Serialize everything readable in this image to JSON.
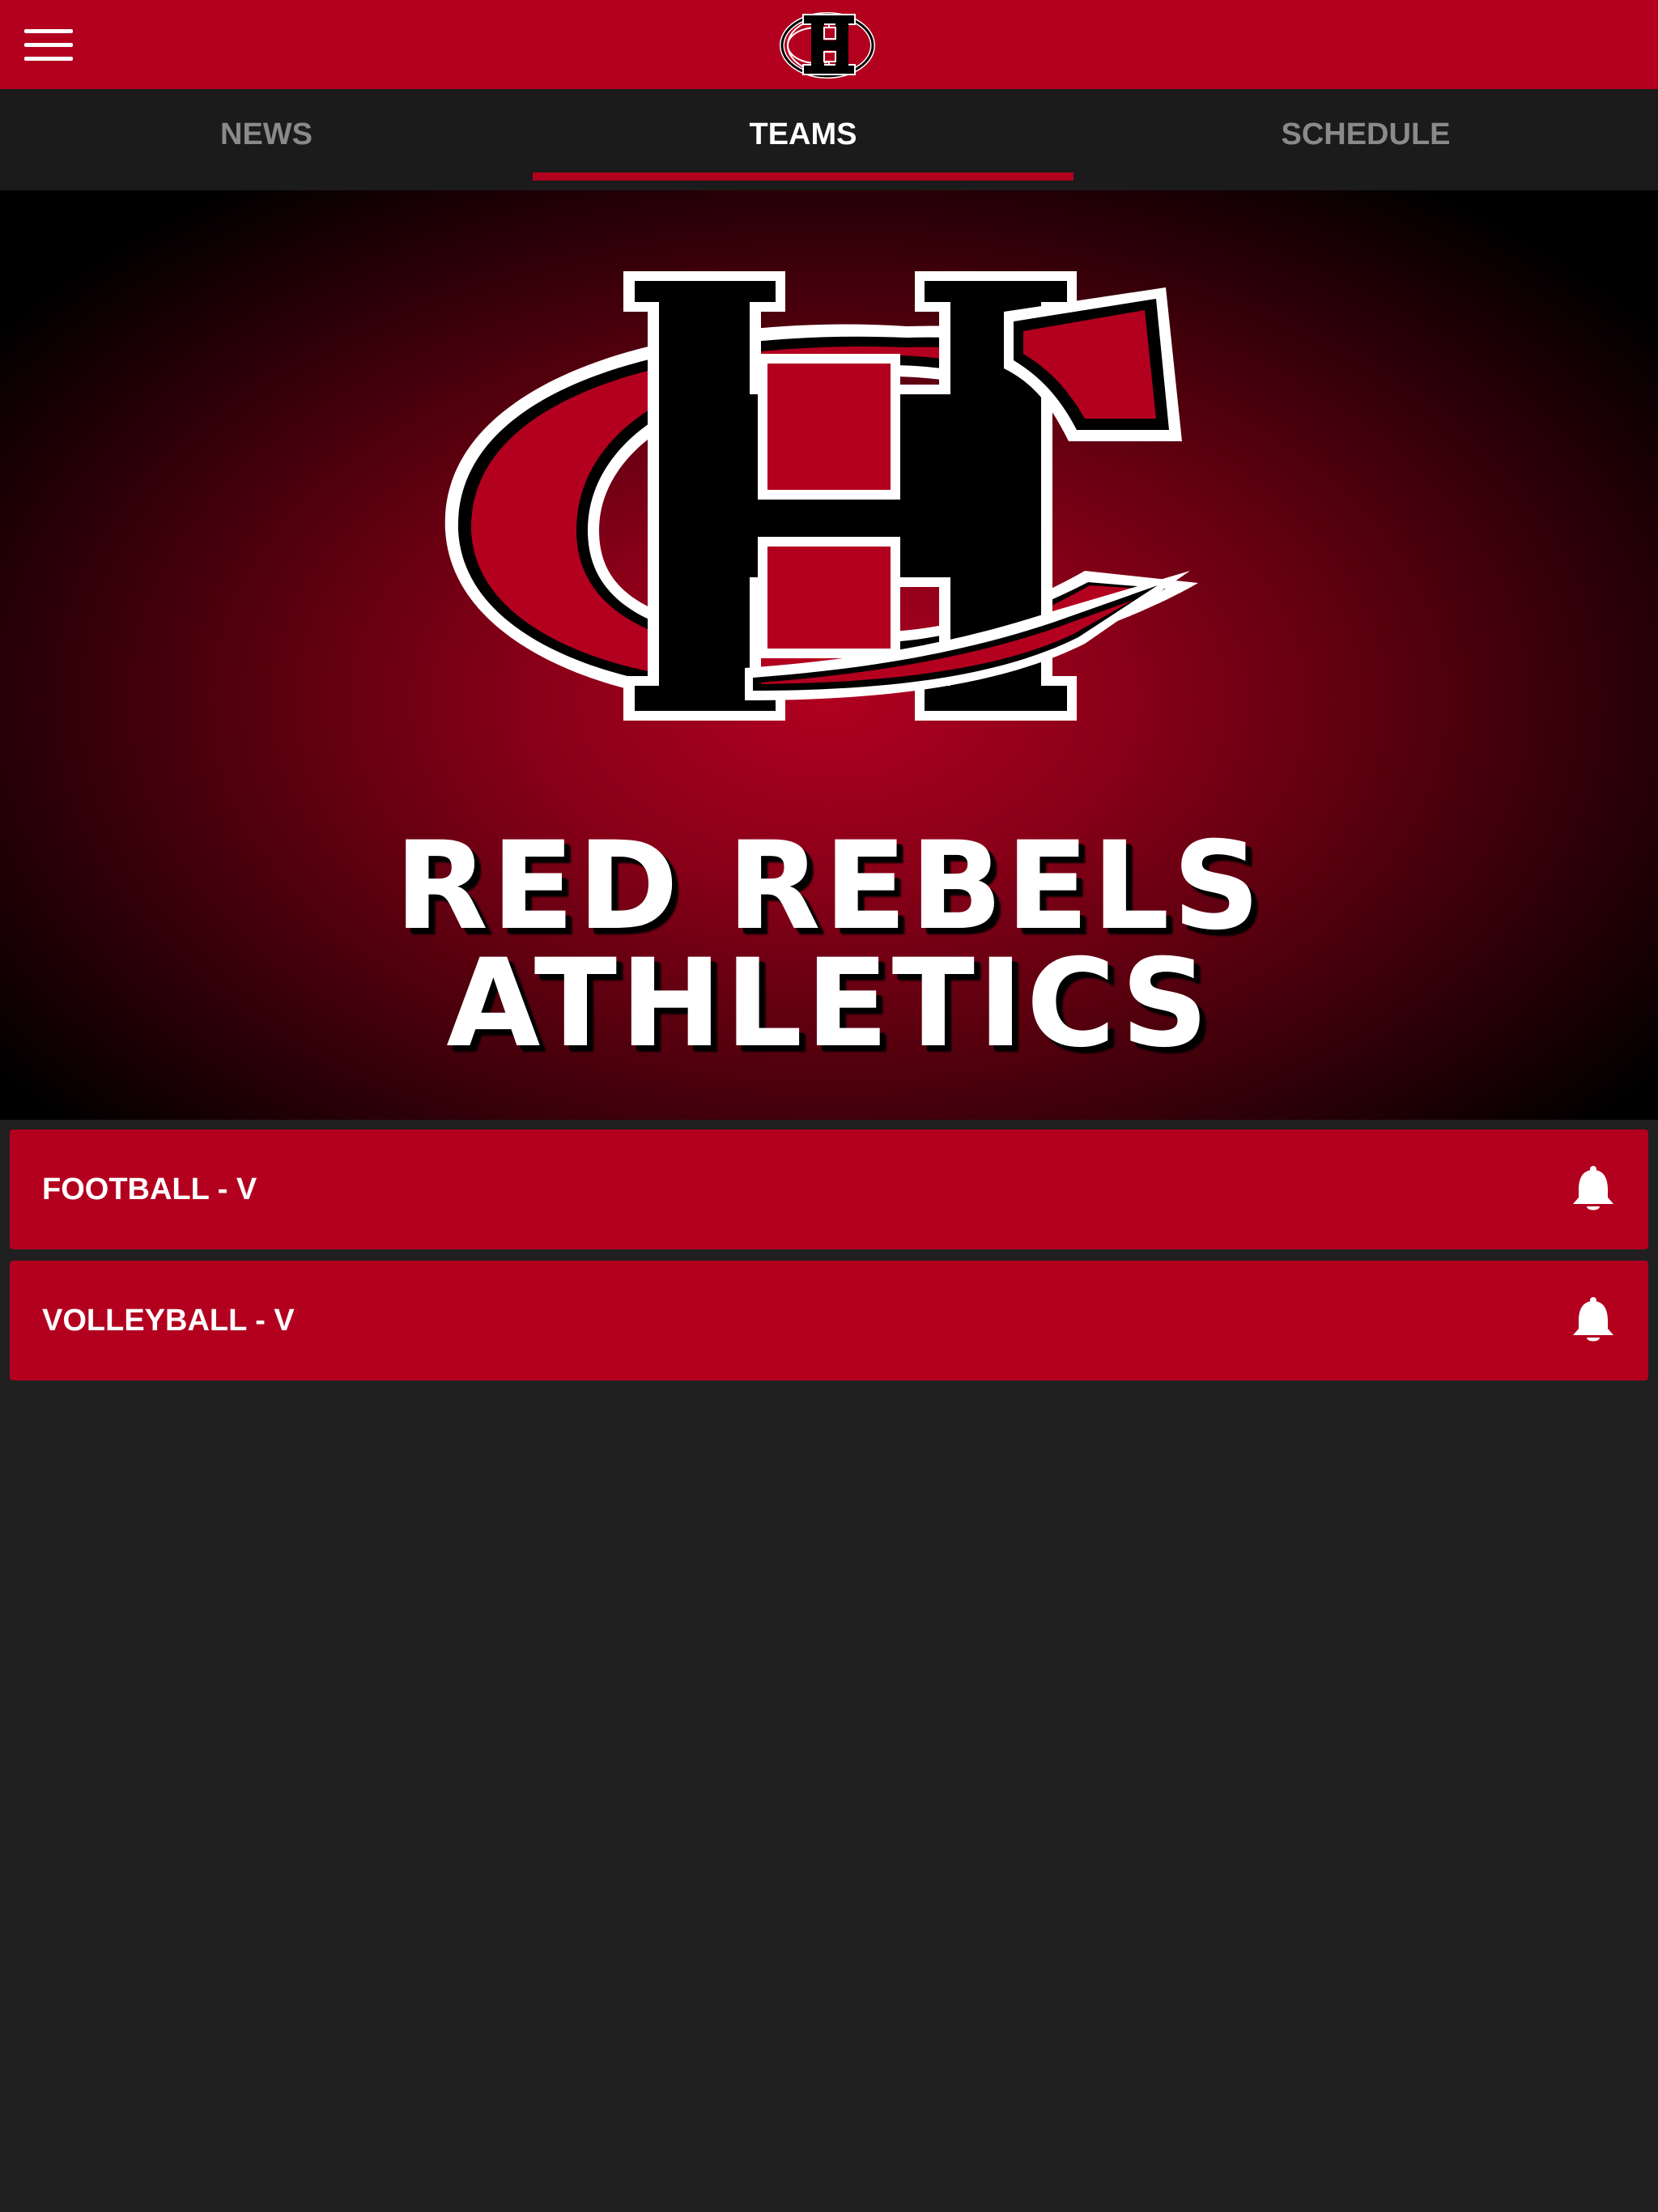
{
  "header": {
    "menu_icon": "hamburger-menu-icon",
    "logo": "hc-school-logo",
    "brand_color": "#b3001f"
  },
  "tabs": [
    {
      "label": "NEWS",
      "active": false
    },
    {
      "label": "TEAMS",
      "active": true
    },
    {
      "label": "SCHEDULE",
      "active": false
    }
  ],
  "hero": {
    "logo": "hc-school-logo",
    "title_line1": "RED REBELS",
    "title_line2": "ATHLETICS"
  },
  "teams": [
    {
      "name": "FOOTBALL - V",
      "icon": "bell-icon"
    },
    {
      "name": "VOLLEYBALL - V",
      "icon": "bell-icon"
    }
  ]
}
